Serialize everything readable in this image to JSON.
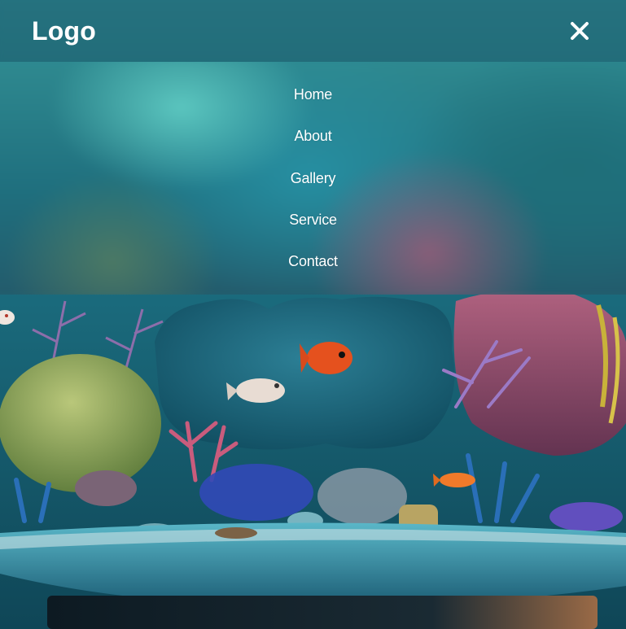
{
  "header": {
    "logo_text": "Logo",
    "close_icon": "close-icon"
  },
  "menu": {
    "items": [
      {
        "label": "Home"
      },
      {
        "label": "About"
      },
      {
        "label": "Gallery"
      },
      {
        "label": "Service"
      },
      {
        "label": "Contact"
      }
    ]
  },
  "colors": {
    "text": "#ffffff",
    "water_teal": "#1f7f8f",
    "coral_pink": "#b5607e"
  }
}
